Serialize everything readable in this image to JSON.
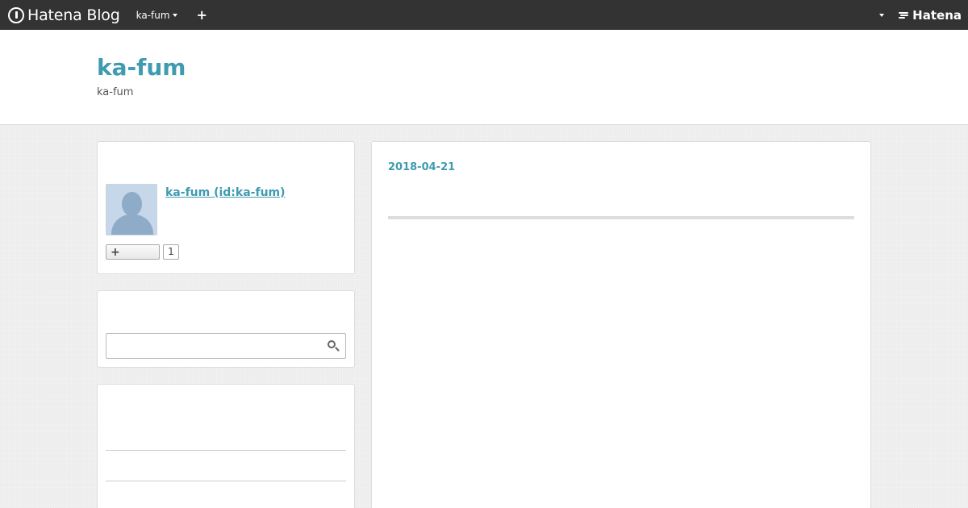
{
  "globalbar": {
    "logo_text": "Hatena Blog",
    "blog_selector": "ka-fum",
    "add_label": "+",
    "brand_right": "Hatena"
  },
  "header": {
    "title": "ka-fum",
    "description": "ka-fum"
  },
  "sidebar": {
    "profile": {
      "name_link": "ka-fum (id:ka-fum)",
      "follow_icon": "+",
      "follow_count": "1"
    },
    "search": {
      "placeholder": ""
    }
  },
  "entry": {
    "date": "2018-04-21"
  },
  "colors": {
    "accent": "#3f9bb0",
    "topbar": "#333333"
  },
  "icons": [
    "hatena-logo-icon",
    "caret-down-icon",
    "plus-icon",
    "hatena-brand-icon",
    "avatar-icon",
    "search-icon"
  ]
}
